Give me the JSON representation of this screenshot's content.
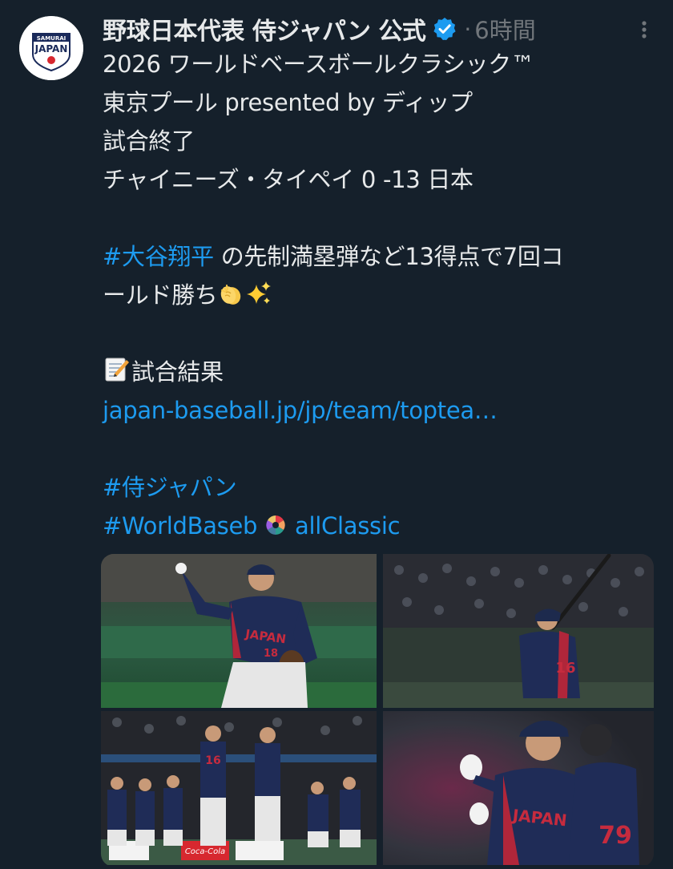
{
  "tweet": {
    "author": {
      "display_name": "野球日本代表 侍ジャパン 公式",
      "avatar_top_text": "SAMURAI",
      "avatar_main_text": "JAPAN",
      "verified_color": "#1d9bf0"
    },
    "dot": "·",
    "timestamp": "6時間",
    "lines": {
      "l1": "2026 ワールドベースボールクラシック™",
      "l2": "東京プール presented by ディップ",
      "l3": "試合終了",
      "l4": "チャイニーズ・タイペイ 0 -13 日本",
      "l5_hashtag": "#大谷翔平",
      "l5_rest": " の先制満塁弾など13得点で7回コ",
      "l6": "ールド勝ち",
      "l7": "試合結果",
      "link": "japan-baseball.jp/jp/team/toptea…",
      "hashtag_samurai": "#侍ジャパン",
      "hashtag_wbc_a": "#WorldBaseb",
      "hashtag_wbc_b": " allClassic"
    },
    "emojis": [
      "clapping-hands",
      "sparkles",
      "memo"
    ],
    "colors": {
      "background": "#15202b",
      "text": "#e7e9ea",
      "link": "#1d9bf0",
      "muted": "#71767b"
    }
  },
  "media": {
    "photos": [
      {
        "name": "photo-pitcher",
        "jersey_text": "JAPAN",
        "number": "18"
      },
      {
        "name": "photo-batter",
        "number": "16"
      },
      {
        "name": "photo-celebration",
        "number": "16",
        "ad_text": "Coca-Cola"
      },
      {
        "name": "photo-players",
        "jersey_text": "JAPAN",
        "number": "79"
      }
    ]
  }
}
